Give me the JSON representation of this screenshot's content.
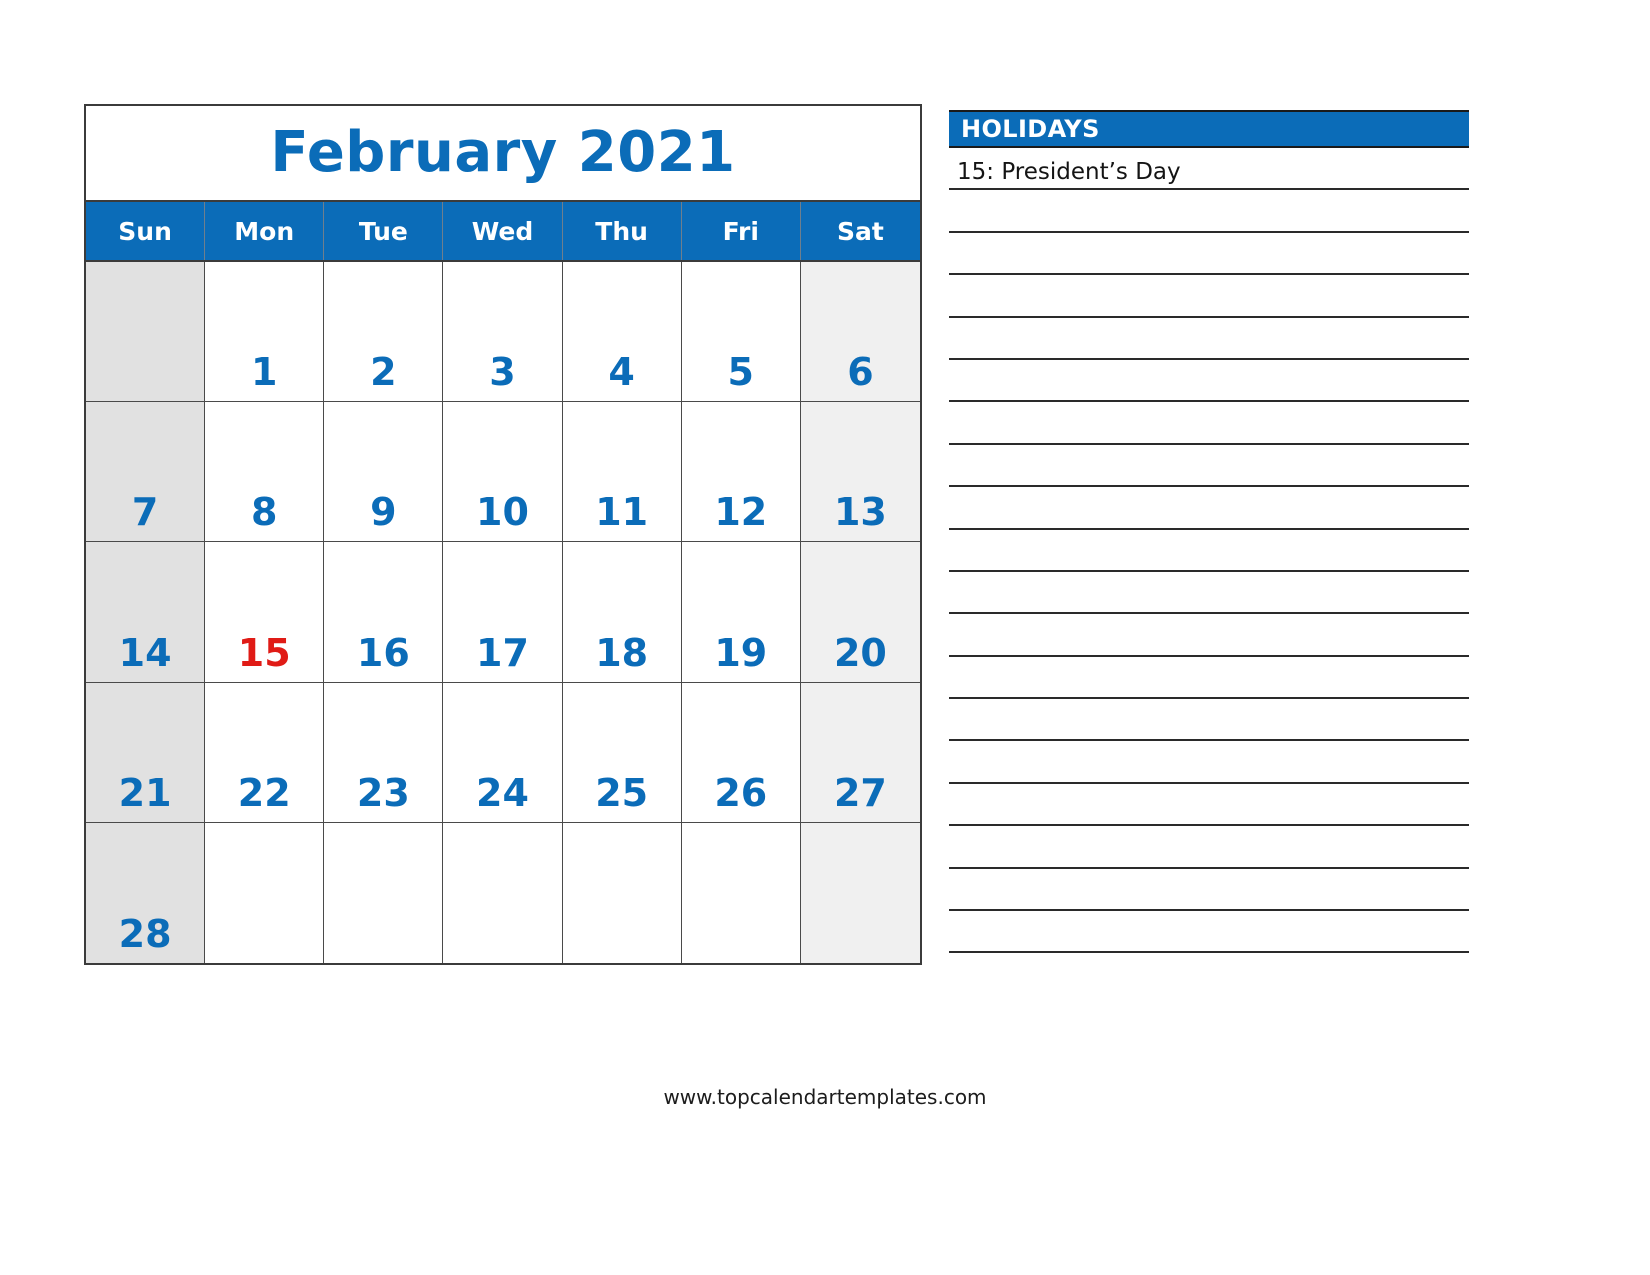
{
  "calendar": {
    "title": "February 2021",
    "month": "February",
    "year": "2021",
    "weekdays": [
      {
        "label": "Sun"
      },
      {
        "label": "Mon"
      },
      {
        "label": "Tue"
      },
      {
        "label": "Wed"
      },
      {
        "label": "Thu"
      },
      {
        "label": "Fri"
      },
      {
        "label": "Sat"
      }
    ],
    "weeks": [
      [
        {
          "day": "",
          "holiday": false
        },
        {
          "day": "1",
          "holiday": false
        },
        {
          "day": "2",
          "holiday": false
        },
        {
          "day": "3",
          "holiday": false
        },
        {
          "day": "4",
          "holiday": false
        },
        {
          "day": "5",
          "holiday": false
        },
        {
          "day": "6",
          "holiday": false
        }
      ],
      [
        {
          "day": "7",
          "holiday": false
        },
        {
          "day": "8",
          "holiday": false
        },
        {
          "day": "9",
          "holiday": false
        },
        {
          "day": "10",
          "holiday": false
        },
        {
          "day": "11",
          "holiday": false
        },
        {
          "day": "12",
          "holiday": false
        },
        {
          "day": "13",
          "holiday": false
        }
      ],
      [
        {
          "day": "14",
          "holiday": false
        },
        {
          "day": "15",
          "holiday": true
        },
        {
          "day": "16",
          "holiday": false
        },
        {
          "day": "17",
          "holiday": false
        },
        {
          "day": "18",
          "holiday": false
        },
        {
          "day": "19",
          "holiday": false
        },
        {
          "day": "20",
          "holiday": false
        }
      ],
      [
        {
          "day": "21",
          "holiday": false
        },
        {
          "day": "22",
          "holiday": false
        },
        {
          "day": "23",
          "holiday": false
        },
        {
          "day": "24",
          "holiday": false
        },
        {
          "day": "25",
          "holiday": false
        },
        {
          "day": "26",
          "holiday": false
        },
        {
          "day": "27",
          "holiday": false
        }
      ],
      [
        {
          "day": "28",
          "holiday": false
        },
        {
          "day": "",
          "holiday": false
        },
        {
          "day": "",
          "holiday": false
        },
        {
          "day": "",
          "holiday": false
        },
        {
          "day": "",
          "holiday": false
        },
        {
          "day": "",
          "holiday": false
        },
        {
          "day": "",
          "holiday": false
        }
      ]
    ]
  },
  "holidays_panel": {
    "title": "HOLIDAYS",
    "entries": [
      {
        "text": "15: President’s Day"
      },
      {
        "text": ""
      },
      {
        "text": ""
      },
      {
        "text": ""
      },
      {
        "text": ""
      },
      {
        "text": ""
      },
      {
        "text": ""
      },
      {
        "text": ""
      },
      {
        "text": ""
      },
      {
        "text": ""
      },
      {
        "text": ""
      },
      {
        "text": ""
      },
      {
        "text": ""
      },
      {
        "text": ""
      },
      {
        "text": ""
      },
      {
        "text": ""
      },
      {
        "text": ""
      },
      {
        "text": ""
      },
      {
        "text": ""
      }
    ]
  },
  "footer": {
    "url": "www.topcalendartemplates.com"
  },
  "colors": {
    "accent_blue": "#0b6cb8",
    "holiday_red": "#e01b16",
    "sunday_shade": "#e1e1e1",
    "saturday_shade": "#f0f0f0",
    "grid_line": "#4a4a4a"
  }
}
